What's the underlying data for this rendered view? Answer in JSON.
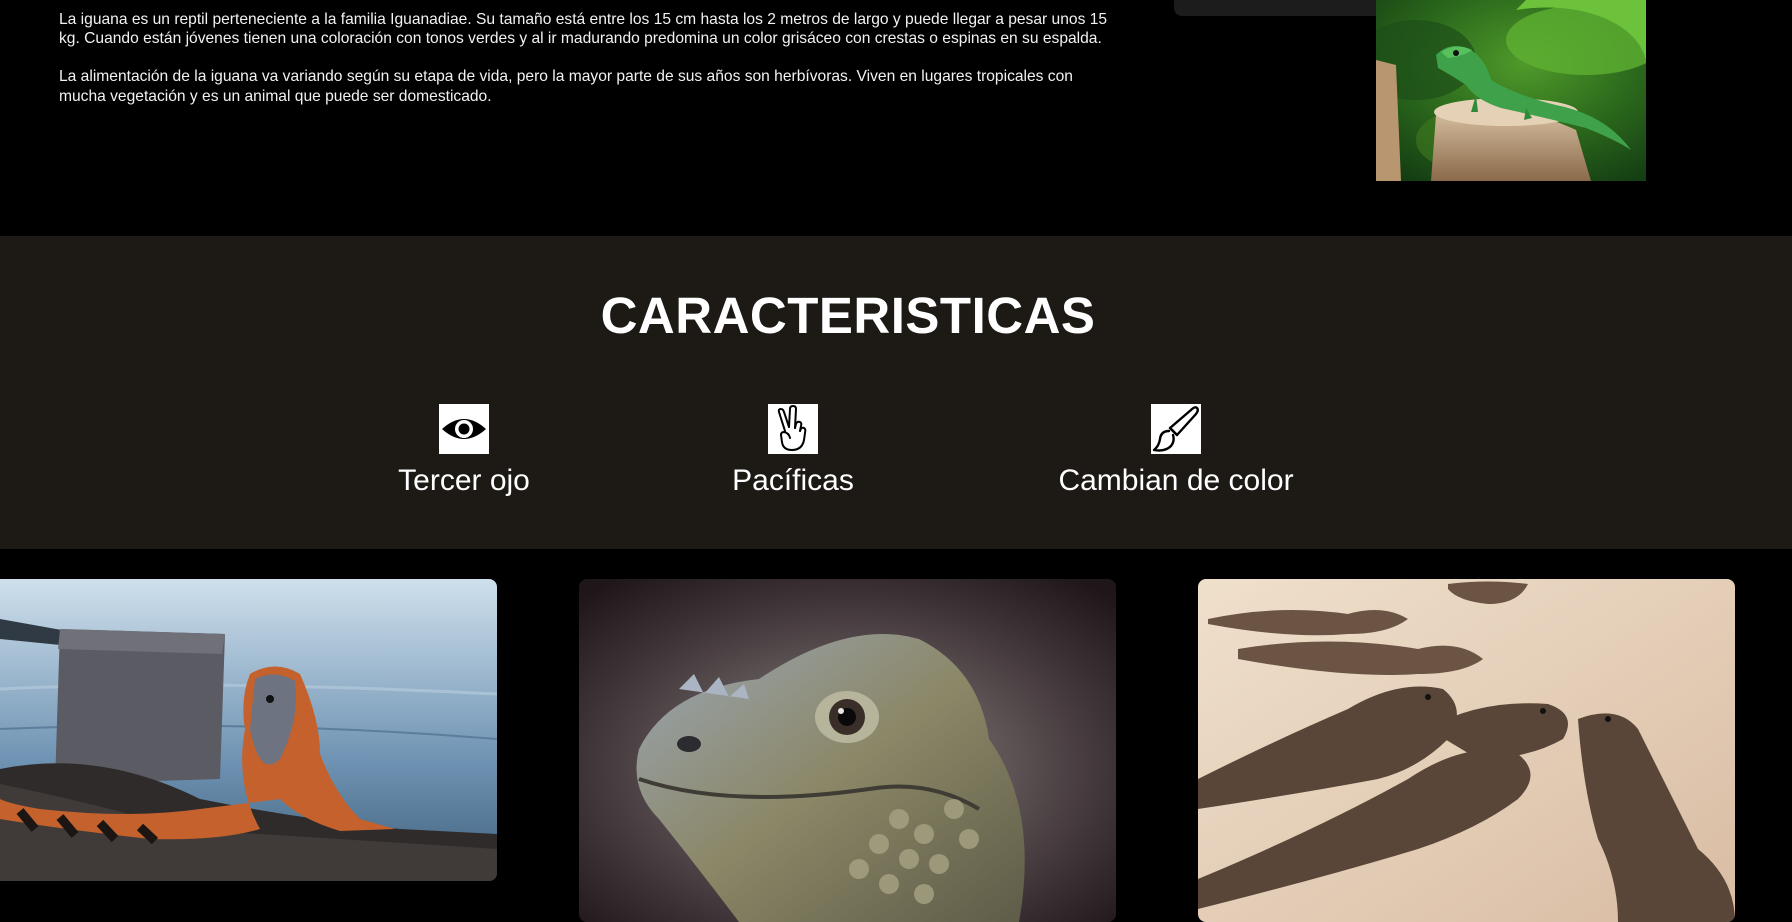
{
  "intro": {
    "paragraphs": [
      "La iguana es un reptil perteneciente a la familia Iguanadiae. Su tamaño está entre los 15 cm hasta los 2 metros de largo y puede llegar a pesar unos 15 kg. Cuando están jóvenes tienen una coloración con tonos verdes y al ir madurando predomina un color grisáceo con crestas o espinas en su espalda.",
      "La alimentación de la iguana va variando según su etapa de vida, pero la mayor parte de sus años son herbívoras. Viven en lugares tropicales con mucha vegetación y es un animal que puede ser domesticado."
    ]
  },
  "features": {
    "title": "CARACTERISTICAS",
    "items": [
      {
        "icon": "eye-icon",
        "label": "Tercer ojo"
      },
      {
        "icon": "peace-hand-icon",
        "label": "Pacíficas"
      },
      {
        "icon": "paintbrush-icon",
        "label": "Cambian de color"
      }
    ]
  },
  "colors": {
    "page_background": "#000000",
    "features_background": "#1d1915",
    "text": "#ffffff"
  }
}
